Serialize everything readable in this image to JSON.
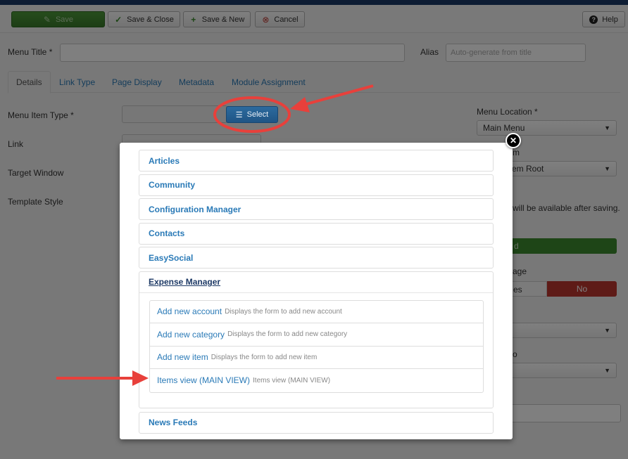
{
  "toolbar": {
    "save": "Save",
    "save_close": "Save & Close",
    "save_new": "Save & New",
    "cancel": "Cancel",
    "help": "Help"
  },
  "form": {
    "menu_title_label": "Menu Title *",
    "menu_title_value": "",
    "alias_label": "Alias",
    "alias_placeholder": "Auto-generate from title",
    "tabs": [
      "Details",
      "Link Type",
      "Page Display",
      "Metadata",
      "Module Assignment"
    ],
    "menu_item_type_label": "Menu Item Type *",
    "select_button": "Select",
    "link_label": "Link",
    "target_window_label": "Target Window",
    "template_style_label": "Template Style",
    "menu_location_label": "Menu Location *",
    "menu_location_value": "Main Menu",
    "parent_item_partial": "m",
    "parent_item_value_partial": "em Root",
    "note_partial": "will be available after saving.",
    "green_button_partial": "d",
    "default_page_partial": "age",
    "toggle_yes_partial": "es",
    "toggle_no": "No",
    "small_partial": "o"
  },
  "modal": {
    "categories": [
      "Articles",
      "Community",
      "Configuration Manager",
      "Contacts",
      "EasySocial"
    ],
    "expanded": {
      "title": "Expense Manager",
      "items": [
        {
          "title": "Add new account",
          "desc": "Displays the form to add new account"
        },
        {
          "title": "Add new category",
          "desc": "Displays the form to add new category"
        },
        {
          "title": "Add new item",
          "desc": "Displays the form to add new item"
        },
        {
          "title": "Items view (MAIN VIEW)",
          "desc": "Items view (MAIN VIEW)"
        }
      ]
    },
    "after": [
      "News Feeds"
    ]
  },
  "colors": {
    "accent": "#2a7ab7",
    "annotation": "#e8403b",
    "save_green": "#3a7b2b",
    "no_red": "#bd362f",
    "topbar": "#1a3867"
  }
}
